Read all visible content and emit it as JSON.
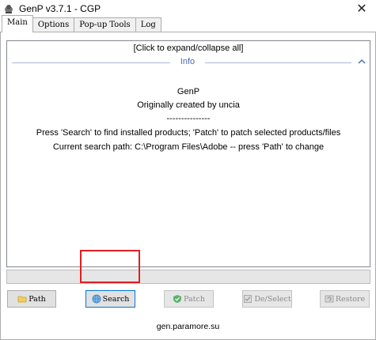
{
  "window": {
    "title": "GenP v3.7.1 - CGP"
  },
  "tabs": [
    {
      "label": "Main",
      "active": true
    },
    {
      "label": "Options",
      "active": false
    },
    {
      "label": "Pop-up Tools",
      "active": false
    },
    {
      "label": "Log",
      "active": false
    }
  ],
  "main": {
    "expand_collapse": "[Click to expand/collapse all]",
    "info_header": "Info",
    "info_lines": [
      "GenP",
      "Originally created by uncia",
      "---------------",
      "Press 'Search' to find installed products; 'Patch' to patch selected products/files",
      "Current search path: C:\\Program Files\\Adobe -- press 'Path' to change"
    ]
  },
  "progress": {
    "value": 0
  },
  "buttons": {
    "path": "Path",
    "search": "Search",
    "patch": "Patch",
    "deselect": "De/Select",
    "restore": "Restore"
  },
  "footer": {
    "link": "gen.paramore.su"
  },
  "colors": {
    "accent": "#0078d7",
    "highlight": "#e02020",
    "info_header": "#4a6fb5"
  }
}
